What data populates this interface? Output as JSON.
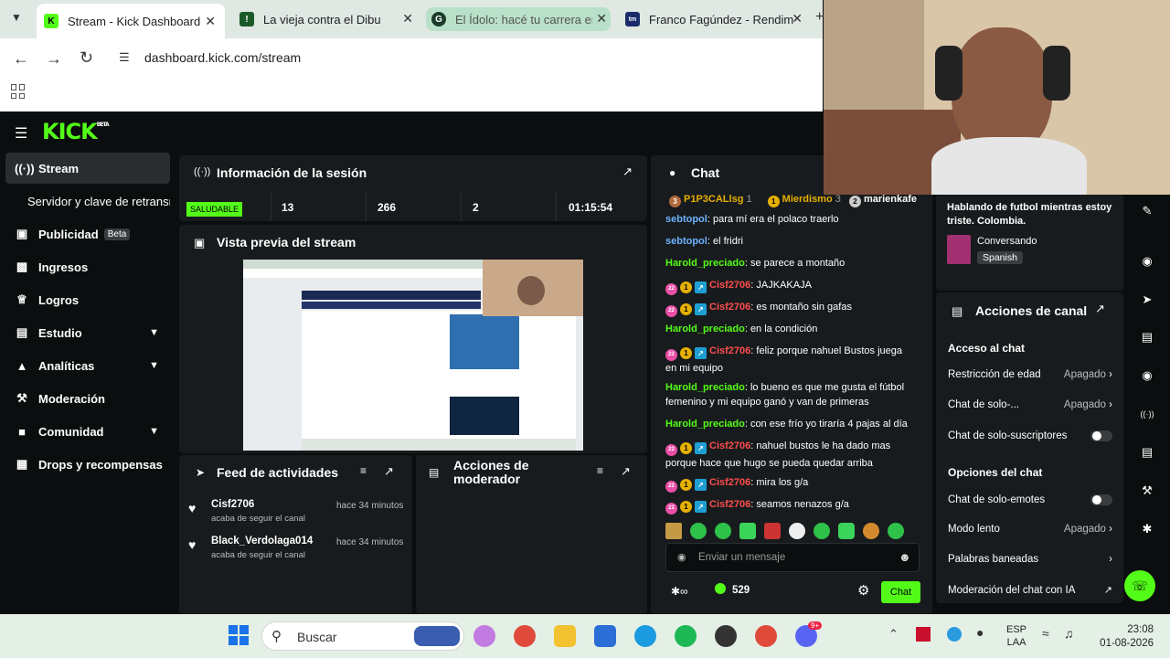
{
  "browser": {
    "tabs": [
      {
        "title": "Stream - Kick Dashboard",
        "active": true
      },
      {
        "title": "La vieja contra el Dibu",
        "active": false
      },
      {
        "title": "El Ídolo: hacé tu carrera en",
        "active": false
      },
      {
        "title": "Franco Fagúndez - Rendim",
        "active": false
      }
    ],
    "url": "dashboard.kick.com/stream"
  },
  "logo": {
    "text": "KICK",
    "beta": "BETA"
  },
  "sidebar": {
    "items": [
      {
        "label": "Stream",
        "icon": "broadcast-icon",
        "active": true
      },
      {
        "label": "Servidor y clave de retransm",
        "icon": ""
      },
      {
        "label": "Publicidad",
        "icon": "ad-icon",
        "badge": "Beta"
      },
      {
        "label": "Ingresos",
        "icon": "money-icon"
      },
      {
        "label": "Logros",
        "icon": "trophy-icon"
      },
      {
        "label": "Estudio",
        "icon": "studio-icon",
        "expandable": true
      },
      {
        "label": "Analíticas",
        "icon": "analytics-icon",
        "expandable": true
      },
      {
        "label": "Moderación",
        "icon": "wrench-icon"
      },
      {
        "label": "Comunidad",
        "icon": "community-icon",
        "expandable": true
      },
      {
        "label": "Drops y recompensas",
        "icon": "drops-icon"
      }
    ]
  },
  "session": {
    "title": "Información de la sesión",
    "health": "SALUDABLE",
    "stats": [
      "13",
      "266",
      "2",
      "01:15:54"
    ]
  },
  "preview": {
    "title": "Vista previa del stream"
  },
  "activity": {
    "title": "Feed de actividades",
    "items": [
      {
        "user": "Cisf2706",
        "action": "acaba de seguir el canal",
        "time": "hace 34 minutos"
      },
      {
        "user": "Black_Verdolaga014",
        "action": "acaba de seguir el canal",
        "time": "hace 34 minutos"
      }
    ]
  },
  "moderator": {
    "title": "Acciones de moderador"
  },
  "chat": {
    "title": "Chat",
    "top_gifters": [
      {
        "name": "P1P3CALlsg",
        "count": "1"
      },
      {
        "name": "Mierdismo",
        "count": "3"
      },
      {
        "name": "marienkafe",
        "count": ""
      }
    ],
    "messages": [
      {
        "user": "sebtopol",
        "text": "para mí era el polaco traerlo",
        "color": "blue",
        "badges": false
      },
      {
        "user": "sebtopol",
        "text": "el fridri",
        "color": "blue",
        "badges": false
      },
      {
        "user": "Harold_preciado",
        "text": "se parece a montaño",
        "color": "green",
        "badges": false
      },
      {
        "user": "Cisf2706",
        "text": "JAJKAKAJA",
        "color": "red",
        "badges": true
      },
      {
        "user": "Cisf2706",
        "text": "es montaño sin gafas",
        "color": "red",
        "badges": true
      },
      {
        "user": "Harold_preciado",
        "text": "en la condición",
        "color": "green",
        "badges": false
      },
      {
        "user": "Cisf2706",
        "text": "feliz porque nahuel Bustos juega en mi equipo",
        "color": "red",
        "badges": true
      },
      {
        "user": "Harold_preciado",
        "text": "lo bueno es que me gusta el fútbol femenino y mi equipo ganó y van de primeras",
        "color": "green",
        "badges": false
      },
      {
        "user": "Harold_preciado",
        "text": "con ese frío yo tiraría 4 pajas al día",
        "color": "green",
        "badges": false
      },
      {
        "user": "Cisf2706",
        "text": "nahuel bustos le ha dado mas porque hace que hugo se pueda quedar arriba",
        "color": "red",
        "badges": true
      },
      {
        "user": "Cisf2706",
        "text": "mira los g/a",
        "color": "red",
        "badges": true
      },
      {
        "user": "Cisf2706",
        "text": "seamos nenazos g/a",
        "color": "red",
        "badges": true
      }
    ],
    "input_placeholder": "Enviar un mensaje",
    "viewer_points": "529",
    "send_label": "Chat"
  },
  "stream_info": {
    "title": "Hablando de futbol mientras estoy triste. Colombia.",
    "category": "Conversando",
    "language": "Spanish"
  },
  "channel_actions": {
    "title": "Acciones de canal",
    "sections": [
      {
        "heading": "Acceso al chat",
        "items": [
          {
            "label": "Restricción de edad",
            "value": "Apagado",
            "kind": "chevron"
          },
          {
            "label": "Chat de solo-...",
            "value": "Apagado",
            "kind": "chevron"
          },
          {
            "label": "Chat de solo-suscriptores",
            "value": "",
            "kind": "toggle"
          }
        ]
      },
      {
        "heading": "Opciones del chat",
        "items": [
          {
            "label": "Chat de solo-emotes",
            "value": "",
            "kind": "toggle"
          },
          {
            "label": "Modo lento",
            "value": "Apagado",
            "kind": "chevron"
          },
          {
            "label": "Palabras baneadas",
            "value": "",
            "kind": "chevron"
          },
          {
            "label": "Moderación del chat con IA",
            "value": "",
            "kind": "external"
          }
        ]
      }
    ]
  },
  "taskbar": {
    "search_placeholder": "Buscar",
    "language": "ESP",
    "region": "LAA",
    "time": "23:08",
    "date": "01-08-2026",
    "discord_badge": "9+"
  },
  "colors": {
    "kick_green": "#53fc18",
    "panel": "#181b1d",
    "bg": "#0b0e0f"
  }
}
